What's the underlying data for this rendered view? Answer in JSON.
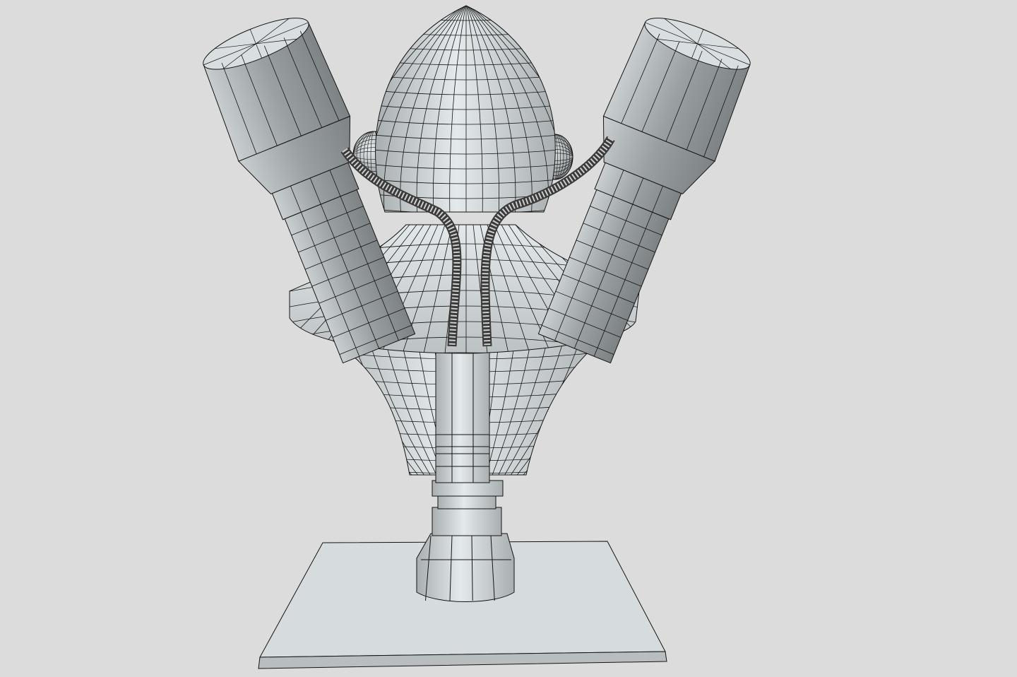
{
  "viewport": {
    "background_color": "#dcdcdc",
    "surface_color": "#d3d9db",
    "shade_color": "#b7bdbf",
    "dark_shade_color": "#9aa0a2",
    "wire_color": "#141414",
    "cable_color": "#3a3a3a"
  },
  "model": {
    "icon": "wireframe-bust-with-lamps-icon"
  }
}
